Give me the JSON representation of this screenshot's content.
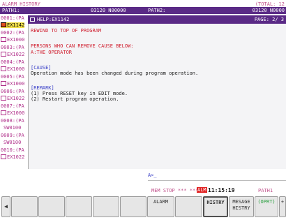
{
  "header": {
    "title": "ALARM HISTORY",
    "total": "(TOTAL: 12",
    "path1_label": "PATH1:",
    "program_id_1": "03120 N00000",
    "path2_label": "PATH2:",
    "program_id_2": "03120 N0000"
  },
  "alarm_list": [
    {
      "number": "0001:(PA",
      "code": "EX1142"
    },
    {
      "number": "0002:(PA",
      "code": "EX1000"
    },
    {
      "number": "0003:(PA",
      "code": "EX1022"
    },
    {
      "number": "0004:(PA",
      "code": "EX1000"
    },
    {
      "number": "0005:(PA",
      "code": "EX1000"
    },
    {
      "number": "0006:(PA",
      "code": "EX1022"
    },
    {
      "number": "0007:(PA",
      "code": "EX1000"
    },
    {
      "number": "0008:(PA",
      "code": "SW0100"
    },
    {
      "number": "0009:(PA",
      "code": "SW0100"
    },
    {
      "number": "0010:(PA",
      "code": "EX1022"
    }
  ],
  "help": {
    "title": "HELP:EX1142",
    "page": "PAGE: 2/ 3",
    "line1": "REWIND TO TOP OF PROGRAM",
    "line2": "PERSONS WHO CAN REMOVE CAUSE BELOW:",
    "line3": "A:THE OPERATOR",
    "cause_header": "[CAUSE]",
    "cause_text": "Operation mode has been changed during program operation.",
    "remedy_header": "[REMARK]",
    "remedy_1": "(1) Press RESET key in EDIT mode.",
    "remedy_2": "(2) Restart program operation."
  },
  "input_prompt": "A>_",
  "status": {
    "mode": "MEM  STOP *** ***",
    "alarm": "ALM",
    "time": "11:15:19",
    "path": "PATH1"
  },
  "softkeys": {
    "alarm": "ALARM",
    "history": "HISTRY",
    "message_history_1": "MESAGE",
    "message_history_2": "HISTRY",
    "operation": "(OPRT)",
    "next": "+"
  },
  "colors": {
    "title_bar": "#5a2a86",
    "alarm_text": "#b0308a",
    "help_heading": "#d02030",
    "section_header": "#3a40c8",
    "selected_item": "#f2e04a"
  }
}
